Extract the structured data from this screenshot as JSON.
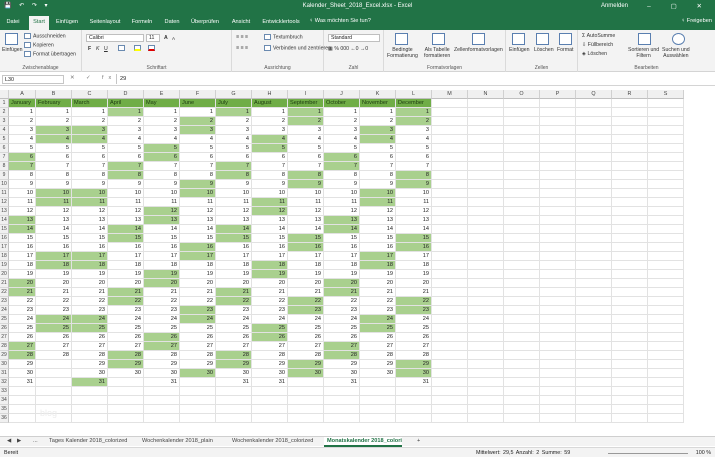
{
  "titlebar": {
    "title": "Kalender_Sheet_2018_Excel.xlsx - Excel",
    "user": "Anmelden",
    "window_controls": "–  ▢  ✕",
    "quick_access": "💾 ↶ ↷ ▾"
  },
  "ribbon_tabs": [
    "Datei",
    "Start",
    "Einfügen",
    "Seitenlayout",
    "Formeln",
    "Daten",
    "Überprüfen",
    "Ansicht",
    "Entwicklertools"
  ],
  "active_tab": "Start",
  "search_label": "♀ Was möchten Sie tun?",
  "share_label": "♀ Freigeben",
  "ribbon": {
    "clipboard": {
      "paste": "Einfügen",
      "cut": "Ausschneiden",
      "copy": "Kopieren",
      "format_painter": "Format übertragen",
      "label": "Zwischenablage"
    },
    "font": {
      "name": "Calibri",
      "size": "11",
      "label": "Schriftart",
      "bold": "F",
      "italic": "K",
      "underline": "U",
      "grow": "A",
      "shrink": "A"
    },
    "alignment": {
      "wrap": "Textumbruch",
      "merge": "Verbinden und zentrieren",
      "label": "Ausrichtung"
    },
    "number": {
      "format": "Standard",
      "label": "Zahl"
    },
    "styles": {
      "conditional": "Bedingte\nFormatierung",
      "as_table": "Als Tabelle\nformatieren",
      "cell_styles": "Zellenformatvorlagen",
      "label": "Formatvorlagen"
    },
    "cells": {
      "insert": "Einfügen",
      "delete": "Löschen",
      "format": "Format",
      "label": "Zellen"
    },
    "editing": {
      "autosum": "AutoSumme",
      "fill": "Füllbereich",
      "clear": "Löschen",
      "sort": "Sortieren und\nFiltern",
      "find": "Suchen und\nAuswählen",
      "label": "Bearbeiten"
    }
  },
  "formula_bar": {
    "name_box": "L30",
    "fx": "✕ ✓ fx",
    "value": "29"
  },
  "columns": [
    "A",
    "B",
    "C",
    "D",
    "E",
    "F",
    "G",
    "H",
    "I",
    "J",
    "K",
    "L",
    "M",
    "N",
    "O",
    "P",
    "Q",
    "R",
    "S"
  ],
  "months": [
    "January",
    "February",
    "March",
    "April",
    "May",
    "June",
    "July",
    "August",
    "September",
    "October",
    "November",
    "December"
  ],
  "month_days": [
    31,
    28,
    31,
    30,
    31,
    30,
    31,
    31,
    30,
    31,
    30,
    31
  ],
  "weekend_highlight": [
    [
      6,
      7,
      13,
      14,
      20,
      21,
      27,
      28
    ],
    [
      3,
      4,
      10,
      11,
      17,
      18,
      24,
      25
    ],
    [
      3,
      4,
      10,
      11,
      17,
      18,
      24,
      25,
      31
    ],
    [
      1,
      7,
      8,
      14,
      15,
      21,
      22,
      28,
      29
    ],
    [
      5,
      6,
      12,
      13,
      19,
      20,
      26,
      27
    ],
    [
      2,
      3,
      9,
      10,
      16,
      17,
      23,
      24,
      30
    ],
    [
      1,
      7,
      8,
      14,
      15,
      21,
      22,
      28,
      29
    ],
    [
      4,
      5,
      11,
      12,
      18,
      19,
      25,
      26
    ],
    [
      1,
      2,
      8,
      9,
      15,
      16,
      22,
      23,
      29,
      30
    ],
    [
      6,
      7,
      13,
      14,
      20,
      21,
      27,
      28
    ],
    [
      3,
      4,
      10,
      11,
      17,
      18,
      24,
      25
    ],
    [
      1,
      2,
      8,
      9,
      15,
      16,
      22,
      23,
      29,
      30
    ]
  ],
  "row_count": 36,
  "watermark": "blog",
  "sheet_tabs": [
    "Tages Kalender 2018_colorized",
    "Wochenkalender 2018_plain",
    "Wochenkalender 2018_colorized",
    "Monatskalender 2018_colorized"
  ],
  "active_sheet": "Monatskalender 2018_colorized",
  "sheet_nav": [
    "◀",
    "▶",
    "..."
  ],
  "add_sheet": "+",
  "status": {
    "ready": "Bereit",
    "summary": "Mittelwert: 29,5   Anzahl: 2   Summe: 59",
    "zoom": "100 %"
  },
  "colors": {
    "excel_green": "#217346",
    "header_green": "#70ad47",
    "weekend_green": "#a9d08e"
  }
}
